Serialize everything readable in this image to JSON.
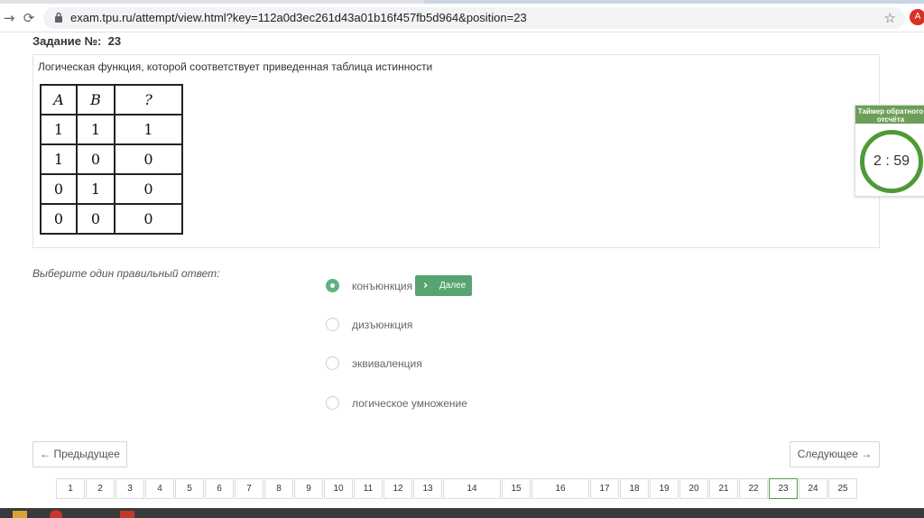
{
  "browser": {
    "url": "exam.tpu.ru/attempt/view.html?key=112a0d3ec261d43a01b16f457fb5d964&position=23",
    "profile_initial": "A"
  },
  "task": {
    "label": "Задание №:",
    "number": "23",
    "question": "Логическая функция, которой соответствует приведенная таблица истинности",
    "truth_table": {
      "headers": [
        "A",
        "B",
        "?"
      ],
      "rows": [
        [
          "1",
          "1",
          "1"
        ],
        [
          "1",
          "0",
          "0"
        ],
        [
          "0",
          "1",
          "0"
        ],
        [
          "0",
          "0",
          "0"
        ]
      ]
    }
  },
  "timer": {
    "title": "Таймер обратного отсчёта",
    "value": "2 : 59",
    "accent_color": "#4e9a38"
  },
  "answers": {
    "prompt": "Выберите один правильный ответ:",
    "options": [
      {
        "label": "конъюнкция",
        "selected": true
      },
      {
        "label": "дизъюнкция",
        "selected": false
      },
      {
        "label": "эквиваленция",
        "selected": false
      },
      {
        "label": "логическое умножение",
        "selected": false
      }
    ],
    "next_button": "Далее"
  },
  "navigation": {
    "prev": "← Предыдущее",
    "next": "Следующее →"
  },
  "pagination": {
    "pages": [
      "1",
      "2",
      "3",
      "4",
      "5",
      "6",
      "7",
      "8",
      "9",
      "10",
      "11",
      "12",
      "13",
      "14",
      "15",
      "16",
      "17",
      "18",
      "19",
      "20",
      "21",
      "22",
      "23",
      "24",
      "25"
    ],
    "current": "23",
    "current_color": "#5a9a3f"
  },
  "colors": {
    "selected_radio": "#5fb381",
    "next_button_bg": "#57a470"
  }
}
